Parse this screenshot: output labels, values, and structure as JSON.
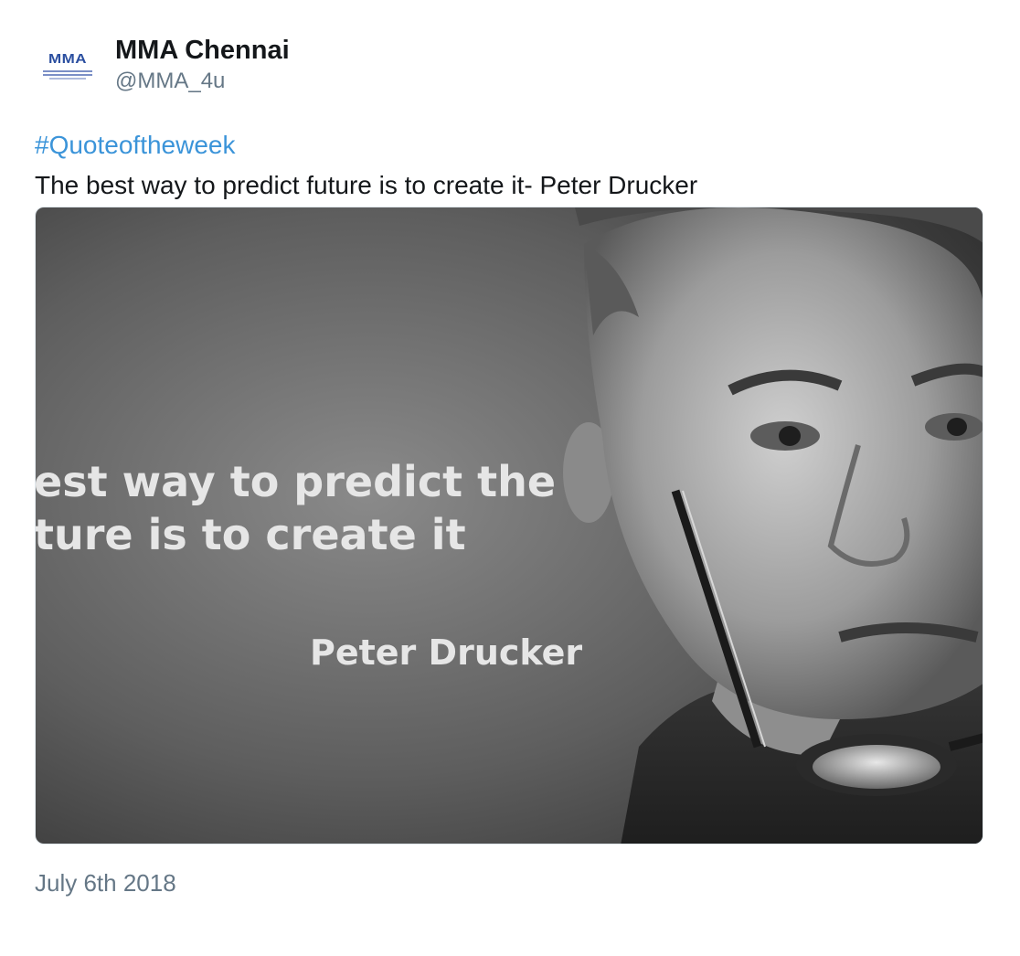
{
  "user": {
    "display_name": "MMA Chennai",
    "handle": "@MMA_4u",
    "avatar_logo_text": "MMA"
  },
  "tweet": {
    "hashtag": "#Quoteoftheweek",
    "text": "The best way to predict future is to create it- Peter Drucker",
    "timestamp": "July 6th 2018"
  },
  "media": {
    "quote_line_1": "est way to predict the",
    "quote_line_2": "ture is to create it",
    "author": "Peter Drucker"
  },
  "colors": {
    "link": "#3b94d9",
    "text": "#14171a",
    "muted": "#657786",
    "logo": "#2b4fa0"
  }
}
